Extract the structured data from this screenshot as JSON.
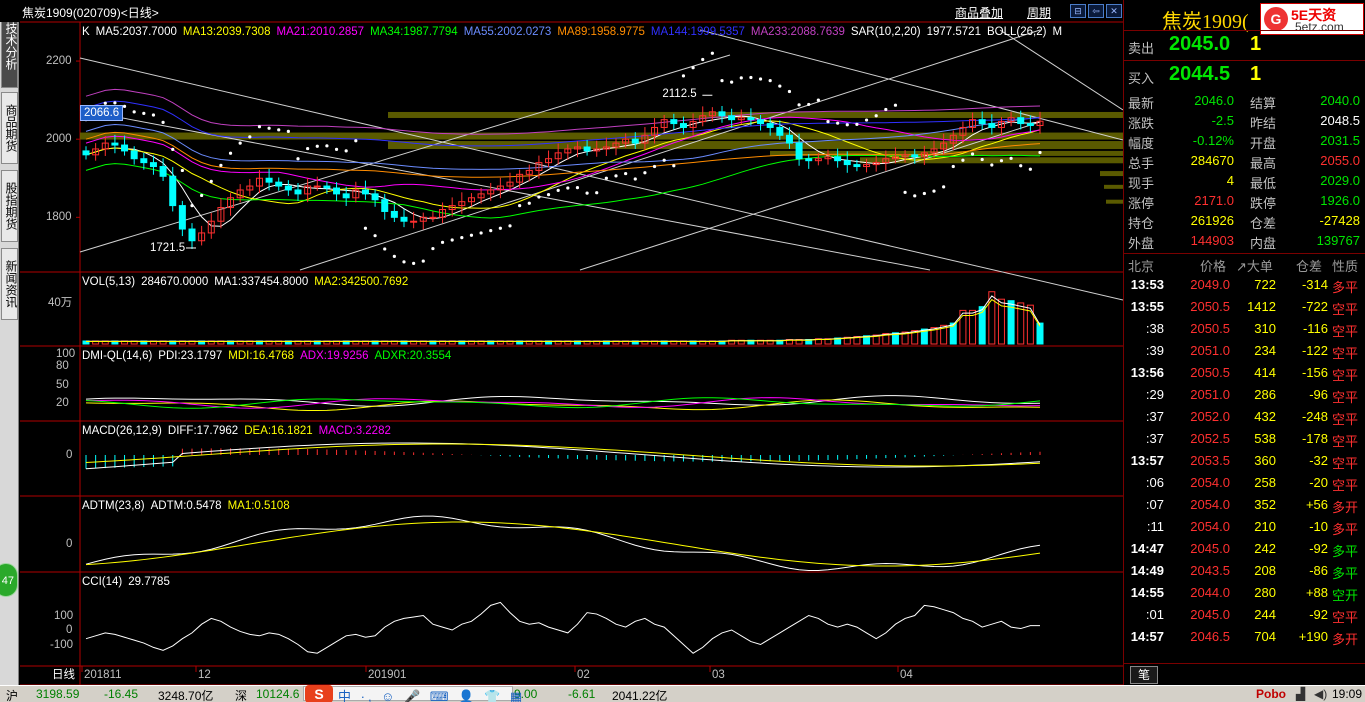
{
  "left_tabs": [
    "技术分析",
    "商品期货",
    "股指期货",
    "新闻资讯"
  ],
  "float_badge": "47",
  "chart_header": {
    "title": "焦炭1909(020709)<日线>",
    "links": [
      "商品叠加",
      "周期"
    ],
    "window_buttons": [
      "restore",
      "back",
      "close"
    ]
  },
  "main_panel": {
    "indicators": [
      {
        "text": "K",
        "color": "#ffffff"
      },
      {
        "text": "MA5:2037.7000",
        "color": "#ffffff"
      },
      {
        "text": "MA13:2039.7308",
        "color": "#ffff00"
      },
      {
        "text": "MA21:2010.2857",
        "color": "#ff00ff"
      },
      {
        "text": "MA34:1987.7794",
        "color": "#00ff00"
      },
      {
        "text": "MA55:2002.0273",
        "color": "#6b8cff"
      },
      {
        "text": "MA89:1958.9775",
        "color": "#ff8c00"
      },
      {
        "text": "MA144:1999.5357",
        "color": "#3030ff"
      },
      {
        "text": "MA233:2088.7639",
        "color": "#c040c0"
      },
      {
        "text": "SAR(10,2,20)",
        "color": "#ffffff"
      },
      {
        "text": "1977.5721",
        "color": "#ffffff"
      },
      {
        "text": "BOLL(26,2)",
        "color": "#ffffff"
      },
      {
        "text": "M",
        "color": "#ffffff"
      }
    ],
    "axis_labels": [
      "2200",
      "2000",
      "1800"
    ],
    "current_price_tag": "2066.6",
    "annotations": {
      "high": "2112.5",
      "low": "1721.5"
    }
  },
  "vol_panel": {
    "indicators": [
      {
        "text": "VOL(5,13)",
        "color": "#ffffff"
      },
      {
        "text": "284670.0000",
        "color": "#ffffff"
      },
      {
        "text": "MA1:337454.8000",
        "color": "#ffffff"
      },
      {
        "text": "MA2:342500.7692",
        "color": "#ffff00"
      }
    ],
    "axis_labels": [
      "40万"
    ]
  },
  "dmi_panel": {
    "indicators": [
      {
        "text": "DMI-QL(14,6)",
        "color": "#ffffff"
      },
      {
        "text": "PDI:23.1797",
        "color": "#ffffff"
      },
      {
        "text": "MDI:16.4768",
        "color": "#ffff00"
      },
      {
        "text": "ADX:19.9256",
        "color": "#ff00ff"
      },
      {
        "text": "ADXR:20.3554",
        "color": "#00ff00"
      }
    ],
    "axis_labels": [
      "100",
      "80",
      "50",
      "20"
    ]
  },
  "macd_panel": {
    "indicators": [
      {
        "text": "MACD(26,12,9)",
        "color": "#ffffff"
      },
      {
        "text": "DIFF:17.7962",
        "color": "#ffffff"
      },
      {
        "text": "DEA:16.1821",
        "color": "#ffff00"
      },
      {
        "text": "MACD:3.2282",
        "color": "#ff00ff"
      }
    ],
    "axis_labels": [
      "0"
    ]
  },
  "adtm_panel": {
    "indicators": [
      {
        "text": "ADTM(23,8)",
        "color": "#ffffff"
      },
      {
        "text": "ADTM:0.5478",
        "color": "#ffffff"
      },
      {
        "text": "MA1:0.5108",
        "color": "#ffff00"
      }
    ],
    "axis_labels": [
      "0"
    ]
  },
  "cci_panel": {
    "indicators": [
      {
        "text": "CCI(14)",
        "color": "#ffffff"
      },
      {
        "text": "29.7785",
        "color": "#ffffff"
      }
    ],
    "axis_labels": [
      "100",
      "0",
      "-100"
    ]
  },
  "x_axis": {
    "period_label": "日线",
    "labels": [
      "201811",
      "12",
      "201901",
      "02",
      "03",
      "04"
    ]
  },
  "quote": {
    "title": "焦炭1909(",
    "logo_top": "5E天资",
    "logo_bottom": "5etz.com",
    "logo_mark": "G",
    "ask": {
      "label": "卖出",
      "price": "2045.0",
      "vol": "1"
    },
    "bid": {
      "label": "买入",
      "price": "2044.5",
      "vol": "1"
    },
    "rows": [
      {
        "l1": "最新",
        "v1": "2046.0",
        "c1": "#00e600",
        "l2": "结算",
        "v2": "2040.0",
        "c2": "#00e600"
      },
      {
        "l1": "涨跌",
        "v1": "-2.5",
        "c1": "#00e600",
        "l2": "昨结",
        "v2": "2048.5",
        "c2": "#ffffff"
      },
      {
        "l1": "幅度",
        "v1": "-0.12%",
        "c1": "#00e600",
        "l2": "开盘",
        "v2": "2031.5",
        "c2": "#00e600"
      },
      {
        "l1": "总手",
        "v1": "284670",
        "c1": "#ffff00",
        "l2": "最高",
        "v2": "2055.0",
        "c2": "#ff3030"
      },
      {
        "l1": "现手",
        "v1": "4",
        "c1": "#ffff00",
        "l2": "最低",
        "v2": "2029.0",
        "c2": "#00e600"
      },
      {
        "l1": "涨停",
        "v1": "2171.0",
        "c1": "#ff3030",
        "l2": "跌停",
        "v2": "1926.0",
        "c2": "#00e600"
      },
      {
        "l1": "持仓",
        "v1": "261926",
        "c1": "#ffff00",
        "l2": "仓差",
        "v2": "-27428",
        "c2": "#ffff00"
      },
      {
        "l1": "外盘",
        "v1": "144903",
        "c1": "#ff3030",
        "l2": "内盘",
        "v2": "139767",
        "c2": "#00e600"
      }
    ]
  },
  "trades": {
    "headers": [
      "北京",
      "价格",
      "↗大单",
      "仓差",
      "性质"
    ],
    "rows": [
      {
        "t": "13:53",
        "p": "2049.0",
        "v": "722",
        "d": "-314",
        "k": "多平",
        "kc": "#ff3030"
      },
      {
        "t": "13:55",
        "p": "2050.5",
        "v": "1412",
        "d": "-722",
        "k": "空平",
        "kc": "#ff3030"
      },
      {
        "t": ":38",
        "p": "2050.5",
        "v": "310",
        "d": "-116",
        "k": "空平",
        "kc": "#ff3030"
      },
      {
        "t": ":39",
        "p": "2051.0",
        "v": "234",
        "d": "-122",
        "k": "空平",
        "kc": "#ff3030"
      },
      {
        "t": "13:56",
        "p": "2050.5",
        "v": "414",
        "d": "-156",
        "k": "空平",
        "kc": "#ff3030"
      },
      {
        "t": ":29",
        "p": "2051.0",
        "v": "286",
        "d": "-96",
        "k": "空平",
        "kc": "#ff3030"
      },
      {
        "t": ":37",
        "p": "2052.0",
        "v": "432",
        "d": "-248",
        "k": "空平",
        "kc": "#ff3030"
      },
      {
        "t": ":37",
        "p": "2052.5",
        "v": "538",
        "d": "-178",
        "k": "空平",
        "kc": "#ff3030"
      },
      {
        "t": "13:57",
        "p": "2053.5",
        "v": "360",
        "d": "-32",
        "k": "空平",
        "kc": "#ff3030"
      },
      {
        "t": ":06",
        "p": "2054.0",
        "v": "258",
        "d": "-20",
        "k": "空平",
        "kc": "#ff3030"
      },
      {
        "t": ":07",
        "p": "2054.0",
        "v": "352",
        "d": "+56",
        "k": "多开",
        "kc": "#ff3030"
      },
      {
        "t": ":11",
        "p": "2054.0",
        "v": "210",
        "d": "-10",
        "k": "多平",
        "kc": "#ff3030"
      },
      {
        "t": "14:47",
        "p": "2045.0",
        "v": "242",
        "d": "-92",
        "k": "多平",
        "kc": "#00e600"
      },
      {
        "t": "14:49",
        "p": "2043.5",
        "v": "208",
        "d": "-86",
        "k": "多平",
        "kc": "#00e600"
      },
      {
        "t": "14:55",
        "p": "2044.0",
        "v": "280",
        "d": "+88",
        "k": "空开",
        "kc": "#00e600"
      },
      {
        "t": ":01",
        "p": "2045.0",
        "v": "244",
        "d": "-92",
        "k": "空平",
        "kc": "#ff3030"
      },
      {
        "t": "14:57",
        "p": "2046.5",
        "v": "704",
        "d": "+190",
        "k": "多开",
        "kc": "#ff3030"
      }
    ],
    "tab": "笔"
  },
  "statusbar": {
    "sh_label": "沪",
    "sh_index": "3198.59",
    "sh_change": "-16.45",
    "sh_amount": "3248.70亿",
    "sz_label": "深",
    "sz_index": "10124.6",
    "sz_tail": "9.00",
    "sz_change": "-6.61",
    "sz_amount": "2041.22亿",
    "ime_mark": "S",
    "ime_icons": "中 ·, ☺ 🎤 ⌨ 👤 👕 ▦",
    "right_brand": "Pobo",
    "time": "19:09"
  },
  "chart_data": [
    {
      "type": "candlestick",
      "panel": "main",
      "x_period_labels": [
        "201811",
        "12",
        "201901",
        "02",
        "03",
        "04"
      ],
      "y_ticks": [
        1800,
        2000,
        2200
      ],
      "ylim": [
        1660,
        2300
      ],
      "high_marker": 2112.5,
      "low_marker": 1721.5,
      "last_tag": 2066.6,
      "closes_approx": [
        1960,
        1975,
        1990,
        1985,
        1970,
        1950,
        1940,
        1930,
        1905,
        1830,
        1770,
        1740,
        1760,
        1790,
        1825,
        1850,
        1870,
        1880,
        1900,
        1890,
        1880,
        1870,
        1860,
        1880,
        1880,
        1875,
        1860,
        1850,
        1870,
        1860,
        1845,
        1815,
        1800,
        1790,
        1790,
        1800,
        1800,
        1820,
        1830,
        1840,
        1850,
        1860,
        1870,
        1880,
        1890,
        1910,
        1920,
        1940,
        1950,
        1965,
        1975,
        1980,
        1970,
        1975,
        1980,
        1990,
        2000,
        1990,
        2010,
        2030,
        2050,
        2040,
        2030,
        2045,
        2060,
        2070,
        2060,
        2050,
        2055,
        2050,
        2040,
        2030,
        2010,
        1990,
        1950,
        1945,
        1950,
        1955,
        1945,
        1935,
        1930,
        1935,
        1940,
        1950,
        1955,
        1960,
        1955,
        1965,
        1975,
        1990,
        2010,
        2030,
        2050,
        2040,
        2030,
        2045,
        2055,
        2040,
        2035,
        2046
      ]
    },
    {
      "type": "bar",
      "panel": "volume",
      "y_ticks_label": "40万",
      "values_approx_wan": [
        4,
        4,
        4,
        4,
        4,
        4,
        4,
        4,
        4,
        4,
        4,
        4,
        4,
        4,
        4,
        4,
        4,
        4,
        4,
        4,
        4,
        4,
        4,
        4,
        4,
        4,
        4,
        4,
        4,
        4,
        4,
        4,
        4,
        4,
        4,
        4,
        4,
        4,
        4,
        4,
        4,
        4,
        4,
        4,
        4,
        4,
        4,
        4,
        4,
        4,
        4,
        4,
        4,
        4,
        4,
        4,
        4,
        4,
        4,
        4,
        4,
        4,
        4,
        4,
        4,
        4,
        4,
        5,
        5,
        5,
        5,
        5,
        5,
        6,
        6,
        6,
        7,
        7,
        8,
        9,
        10,
        11,
        12,
        14,
        15,
        16,
        18,
        20,
        22,
        25,
        28,
        45,
        45,
        50,
        70,
        60,
        58,
        55,
        52,
        28
      ]
    },
    {
      "type": "line",
      "panel": "dmi",
      "y_ticks": [
        20,
        50,
        80,
        100
      ],
      "series": [
        {
          "name": "PDI",
          "last": 23.1797
        },
        {
          "name": "MDI",
          "last": 16.4768
        },
        {
          "name": "ADX",
          "last": 19.9256
        },
        {
          "name": "ADXR",
          "last": 20.3554
        }
      ]
    },
    {
      "type": "line",
      "panel": "macd",
      "y_ticks": [
        0
      ],
      "series": [
        {
          "name": "DIFF",
          "last": 17.7962
        },
        {
          "name": "DEA",
          "last": 16.1821
        },
        {
          "name": "MACD",
          "last": 3.2282
        }
      ]
    },
    {
      "type": "line",
      "panel": "adtm",
      "y_ticks": [
        0
      ],
      "series": [
        {
          "name": "ADTM",
          "last": 0.5478
        },
        {
          "name": "MA1",
          "last": 0.5108
        }
      ]
    },
    {
      "type": "line",
      "panel": "cci",
      "y_ticks": [
        -100,
        0,
        100
      ],
      "series": [
        {
          "name": "CCI(14)",
          "last": 29.7785,
          "values_approx": [
            -60,
            -40,
            -20,
            -30,
            -50,
            -70,
            -90,
            -120,
            -140,
            -110,
            -60,
            -20,
            40,
            80,
            60,
            20,
            -10,
            -30,
            -40,
            -20,
            -30,
            -60,
            -100,
            -150,
            -160,
            -120,
            -80,
            -40,
            -30,
            -50,
            -40,
            20,
            60,
            80,
            90,
            100,
            40,
            20,
            0,
            40,
            60,
            110,
            170,
            190,
            120,
            60,
            40,
            50,
            20,
            0,
            -20,
            40,
            120,
            110,
            80,
            40,
            20,
            60,
            80,
            40,
            20,
            -40,
            -100,
            -160,
            -120,
            -60,
            -20,
            0,
            -40,
            -80,
            -100,
            -60,
            -20,
            20,
            60,
            100,
            80,
            40,
            20,
            40,
            20,
            -20,
            -60,
            -20,
            40,
            80,
            100,
            170,
            160,
            140,
            120,
            80,
            60,
            20,
            40,
            60,
            20,
            10,
            30,
            29.78
          ]
        }
      ]
    }
  ]
}
